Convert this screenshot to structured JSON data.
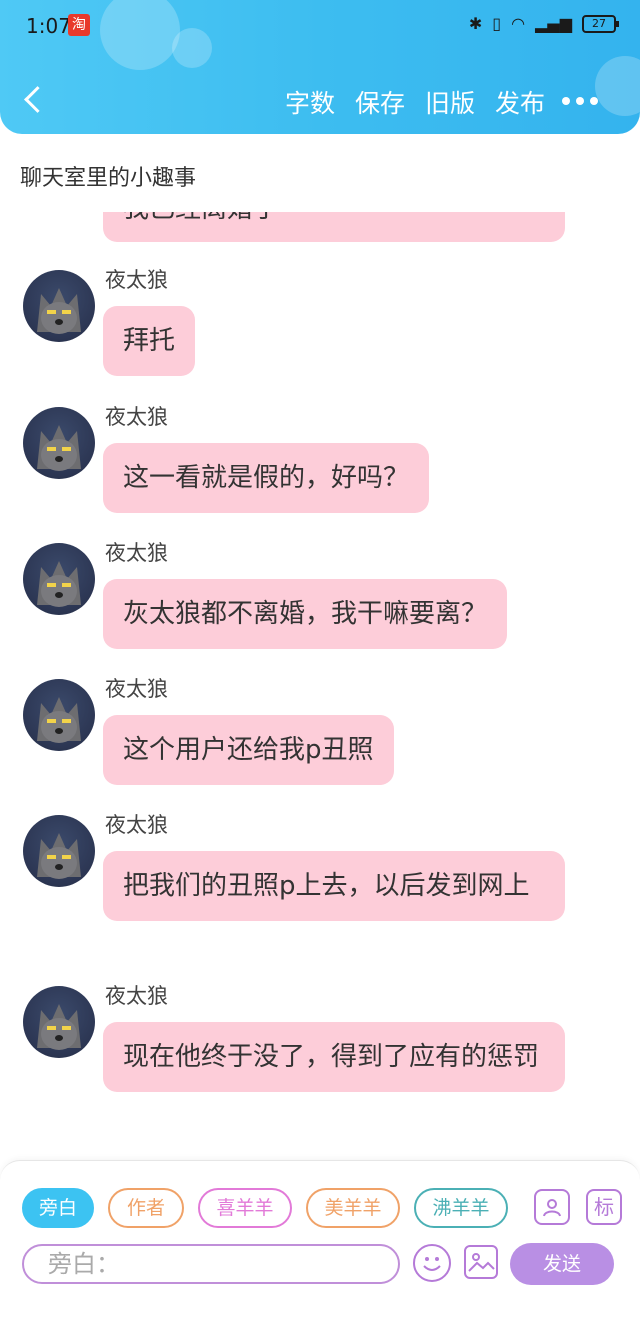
{
  "status_bar": {
    "time": "1:07",
    "taobao_badge": "淘",
    "battery": "27"
  },
  "toolbar": {
    "word_count": "字数",
    "save": "保存",
    "old_version": "旧版",
    "publish": "发布"
  },
  "doc_title": "聊天室里的小趣事",
  "chat": {
    "partial_top_text": "我已经离婚了",
    "messages": [
      {
        "sender": "夜太狼",
        "text": "拜托"
      },
      {
        "sender": "夜太狼",
        "text": "这一看就是假的，好吗？"
      },
      {
        "sender": "夜太狼",
        "text": "灰太狼都不离婚，我干嘛要离？"
      },
      {
        "sender": "夜太狼",
        "text": "这个用户还给我p丑照"
      },
      {
        "sender": "夜太狼",
        "text": "把我们的丑照p上去，以后发到网上"
      },
      {
        "sender": "夜太狼",
        "text": "现在他终于没了，得到了应有的惩罚"
      }
    ]
  },
  "bottom_panel": {
    "roles": [
      {
        "label": "旁白",
        "color": "#3cc3f2",
        "active": true
      },
      {
        "label": "作者",
        "color": "#f0a268",
        "active": false
      },
      {
        "label": "喜羊羊",
        "color": "#e27ad8",
        "active": false
      },
      {
        "label": "美羊羊",
        "color": "#f0a268",
        "active": false
      },
      {
        "label": "沸羊羊",
        "color": "#4bb0b5",
        "active": false
      }
    ],
    "mark_label": "标",
    "input_placeholder": "旁白：",
    "send_label": "发送"
  }
}
